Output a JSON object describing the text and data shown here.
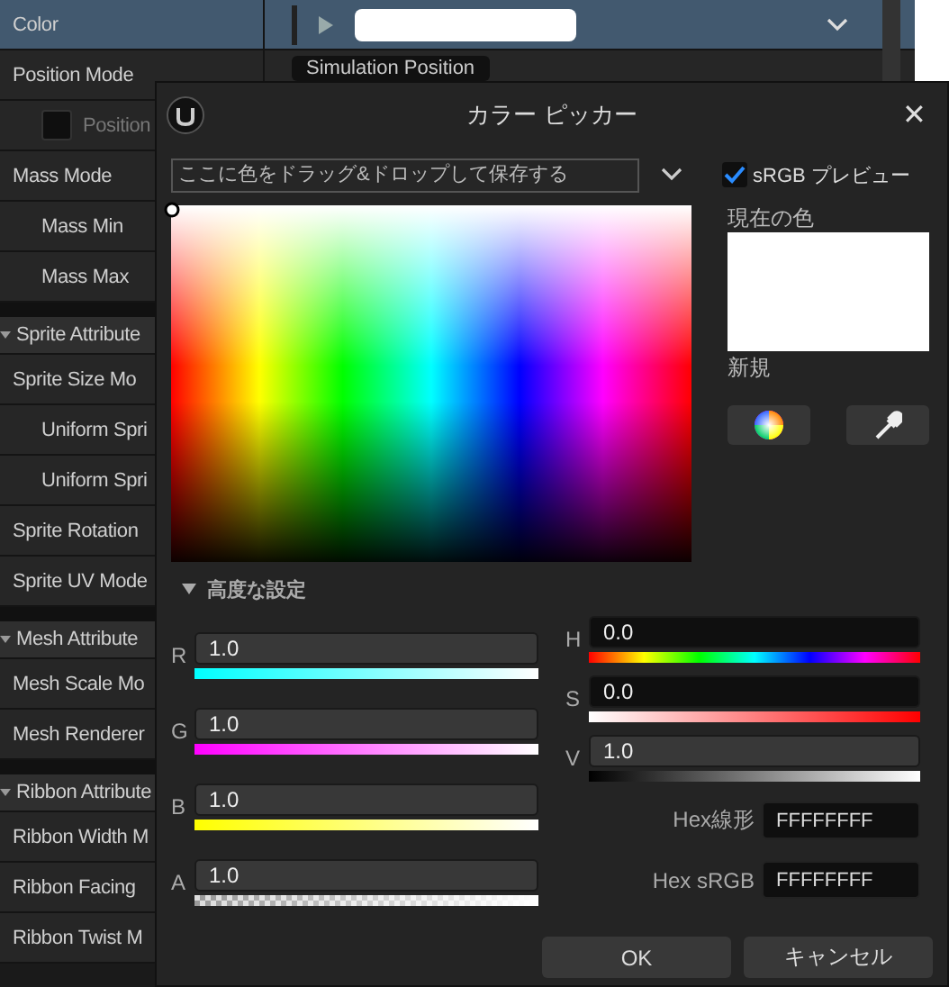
{
  "properties": [
    {
      "kind": "row",
      "label": "Color",
      "selected": true,
      "editor": {
        "kind": "color"
      }
    },
    {
      "kind": "row",
      "label": "Position Mode",
      "selected": false,
      "editor": {
        "kind": "combo",
        "value": "Simulation Position"
      },
      "children": [
        {
          "kind": "check",
          "label": "Position",
          "checked": false,
          "selected": false
        }
      ]
    },
    {
      "kind": "row",
      "label": "Mass Mode",
      "selected": false,
      "children": [
        {
          "kind": "row",
          "label": "Mass Min",
          "selected": false
        },
        {
          "kind": "row",
          "label": "Mass Max",
          "selected": false
        }
      ]
    },
    {
      "kind": "category",
      "label": "Sprite Attribute",
      "expanded": true
    },
    {
      "kind": "row",
      "label": "Sprite Size Mo",
      "selected": false,
      "children": [
        {
          "kind": "row",
          "label": "Uniform Spri",
          "selected": false
        },
        {
          "kind": "row",
          "label": "Uniform Spri",
          "selected": false
        }
      ]
    },
    {
      "kind": "row",
      "label": "Sprite Rotation",
      "selected": false
    },
    {
      "kind": "row",
      "label": "Sprite UV Mode",
      "selected": false
    },
    {
      "kind": "category",
      "label": "Mesh Attribute",
      "expanded": true
    },
    {
      "kind": "row",
      "label": "Mesh Scale Mo",
      "selected": false
    },
    {
      "kind": "row",
      "label": "Mesh Renderer",
      "selected": false
    },
    {
      "kind": "category",
      "label": "Ribbon Attribute",
      "expanded": true
    },
    {
      "kind": "row",
      "label": "Ribbon Width M",
      "selected": false
    },
    {
      "kind": "row",
      "label": "Ribbon Facing",
      "selected": false
    },
    {
      "kind": "row",
      "label": "Ribbon Twist M",
      "selected": false
    }
  ],
  "dialog": {
    "title": "カラー ピッカー",
    "close": "✕",
    "saved_colors": {
      "placeholder": "ここに色をドラッグ&ドロップして保存する"
    },
    "srgb_preview": {
      "label": "sRGB プレビュー",
      "checked": true
    },
    "current_label": "現在の色",
    "new_label": "新規",
    "advanced": {
      "label": "高度な設定",
      "expanded": true
    },
    "rgba": [
      {
        "kind": "r",
        "label": "R",
        "value": "1.0"
      },
      {
        "kind": "g",
        "label": "G",
        "value": "1.0"
      },
      {
        "kind": "b",
        "label": "B",
        "value": "1.0"
      },
      {
        "kind": "a",
        "label": "A",
        "value": "1.0"
      }
    ],
    "hsv": [
      {
        "kind": "h",
        "label": "H",
        "value": "0.0"
      },
      {
        "kind": "s",
        "label": "S",
        "value": "0.0"
      },
      {
        "kind": "v",
        "label": "V",
        "value": "1.0"
      }
    ],
    "hex": [
      {
        "label": "Hex線形",
        "value": "FFFFFFFF"
      },
      {
        "label": "Hex sRGB",
        "value": "FFFFFFFF"
      }
    ],
    "buttons": [
      "OK",
      "キャンセル"
    ]
  }
}
